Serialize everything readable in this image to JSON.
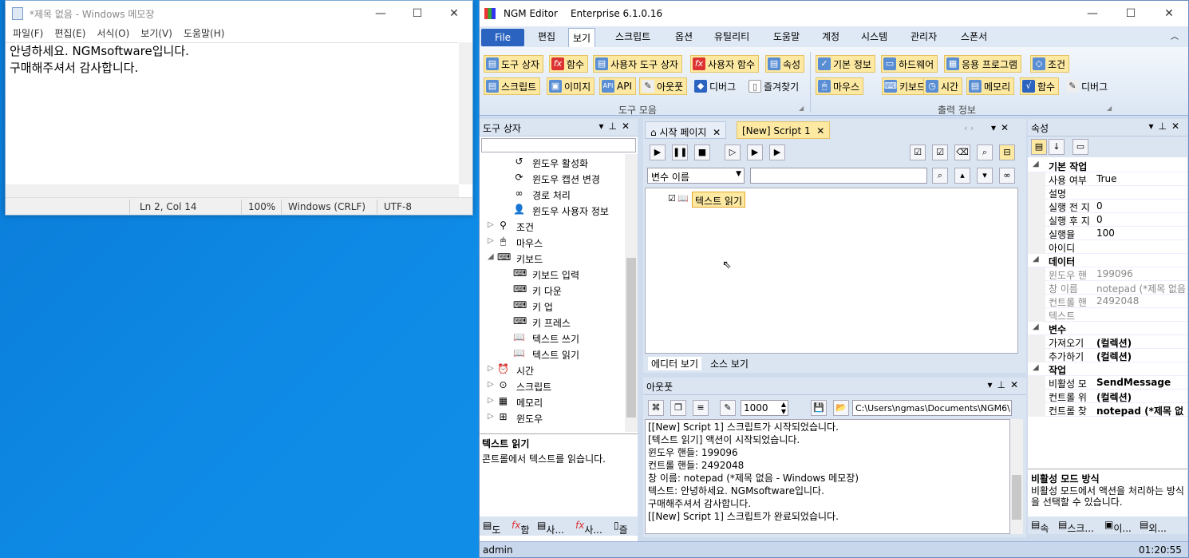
{
  "notepad": {
    "title": "*제목 없음 - Windows 메모장",
    "menu": [
      "파일(F)",
      "편집(E)",
      "서식(O)",
      "보기(V)",
      "도움말(H)"
    ],
    "line1": "안녕하세요. NGMsoftware입니다.",
    "line2": "구매해주셔서 감사합니다.",
    "status": {
      "pos": "Ln 2, Col 14",
      "zoom": "100%",
      "eol": "Windows (CRLF)",
      "enc": "UTF-8"
    }
  },
  "ngm": {
    "app": "NGM Editor",
    "edition": "Enterprise 6.1.0.16",
    "tabs": [
      "File",
      "편집",
      "보기",
      "스크립트",
      "옵션",
      "유틸리티",
      "도움말",
      "계정",
      "시스템",
      "관리자",
      "스폰서"
    ],
    "ribbon": {
      "group1_row1": [
        "도구 상자",
        "함수",
        "사용자 도구 상자",
        "사용자 함수",
        "속성"
      ],
      "group1_row2": [
        "스크립트",
        "이미지",
        "API",
        "아웃풋",
        "디버그",
        "즐겨찾기"
      ],
      "group1_label": "도구 모음",
      "group2_row1": [
        "기본 정보",
        "하드웨어",
        "응용 프로그램",
        "조건"
      ],
      "group2_row2": [
        "마우스",
        "키보드",
        "시간",
        "메모리",
        "함수",
        "디버그"
      ],
      "group2_label": "출력 정보"
    },
    "toolbox": {
      "title": "도구 상자",
      "items": [
        {
          "label": "윈도우 활성화",
          "icon": "↺",
          "lvl": 2
        },
        {
          "label": "윈도우 캡션 변경",
          "icon": "⟳",
          "lvl": 2
        },
        {
          "label": "경로 처리",
          "icon": "∞",
          "lvl": 2
        },
        {
          "label": "윈도우 사용자 정보",
          "icon": "👤",
          "lvl": 2
        },
        {
          "label": "조건",
          "icon": "⚲",
          "lvl": 1,
          "arrow": "▷"
        },
        {
          "label": "마우스",
          "icon": "🖱",
          "lvl": 1,
          "arrow": "▷"
        },
        {
          "label": "키보드",
          "icon": "⌨",
          "lvl": 1,
          "arrow": "◢"
        },
        {
          "label": "키보드 입력",
          "icon": "⌨",
          "lvl": 2
        },
        {
          "label": "키 다운",
          "icon": "⌨",
          "lvl": 2
        },
        {
          "label": "키 업",
          "icon": "⌨",
          "lvl": 2
        },
        {
          "label": "키 프레스",
          "icon": "⌨",
          "lvl": 2
        },
        {
          "label": "텍스트 쓰기",
          "icon": "📖",
          "lvl": 2
        },
        {
          "label": "텍스트 읽기",
          "icon": "📖",
          "lvl": 2
        },
        {
          "label": "시간",
          "icon": "⏰",
          "lvl": 1,
          "arrow": "▷"
        },
        {
          "label": "스크립트",
          "icon": "⊙",
          "lvl": 1,
          "arrow": "▷"
        },
        {
          "label": "메모리",
          "icon": "▦",
          "lvl": 1,
          "arrow": "▷"
        },
        {
          "label": "윈도우",
          "icon": "⊞",
          "lvl": 1,
          "arrow": "▷"
        }
      ],
      "desc_title": "텍스트 읽기",
      "desc_text": "콘트롤에서 텍스트를 읽습니다.",
      "bottom_tabs": [
        "도",
        "함",
        "사...",
        "사...",
        "즐"
      ]
    },
    "editor": {
      "tab_start": "시작 페이지",
      "tab_script": "[New] Script 1",
      "var_select": "변수 이름",
      "node": "텍스트 읽기",
      "view_editor": "에디터 보기",
      "view_source": "소스 보기"
    },
    "output": {
      "title": "아웃풋",
      "count": "1000",
      "path": "C:\\Users\\ngmas\\Documents\\NGM6\\",
      "lines": [
        "[[New] Script 1] 스크립트가 시작되었습니다.",
        "[텍스트 읽기] 액션이 시작되었습니다.",
        "윈도우 핸들: 199096",
        "컨트롤 핸들: 2492048",
        "창 이름: notepad (*제목 없음 - Windows 메모장)",
        "텍스트: 안녕하세요. NGMsoftware입니다.",
        "구매해주셔서 감사합니다.",
        "[[New] Script 1] 스크립트가 완료되었습니다."
      ]
    },
    "props": {
      "title": "속성",
      "rows": [
        {
          "k": "기본 작업",
          "v": "",
          "cat": true
        },
        {
          "k": "사용 여부",
          "v": "True"
        },
        {
          "k": "설명",
          "v": ""
        },
        {
          "k": "실행 전 지",
          "v": "0"
        },
        {
          "k": "실행 후 지",
          "v": "0"
        },
        {
          "k": "실행율",
          "v": "100"
        },
        {
          "k": "아이디",
          "v": ""
        },
        {
          "k": "데이터",
          "v": "",
          "cat": true
        },
        {
          "k": "윈도우 핸",
          "v": "199096",
          "gray": true
        },
        {
          "k": "창 이름",
          "v": "notepad (*제목 없음",
          "gray": true
        },
        {
          "k": "컨트롤 핸",
          "v": "2492048",
          "gray": true
        },
        {
          "k": "텍스트",
          "v": "",
          "gray": true
        },
        {
          "k": "변수",
          "v": "",
          "cat": true
        },
        {
          "k": "가져오기",
          "v": "(컬렉션)",
          "bold": true
        },
        {
          "k": "추가하기",
          "v": "(컬렉션)",
          "bold": true
        },
        {
          "k": "작업",
          "v": "",
          "cat": true
        },
        {
          "k": "비활성 모",
          "v": "SendMessage",
          "bold": true
        },
        {
          "k": "컨트롤 위",
          "v": "(컬렉션)",
          "bold": true
        },
        {
          "k": "컨트롤 찾",
          "v": "notepad (*제목 없",
          "bold": true
        }
      ],
      "desc_title": "비활성 모드 방식",
      "desc_text": "비활성 모드에서 액션을 처리하는 방식을 선택할 수 있습니다.",
      "bottom_tabs": [
        "속",
        "스크...",
        "이...",
        "외..."
      ]
    },
    "status_user": "admin",
    "status_time": "01:20:55"
  }
}
